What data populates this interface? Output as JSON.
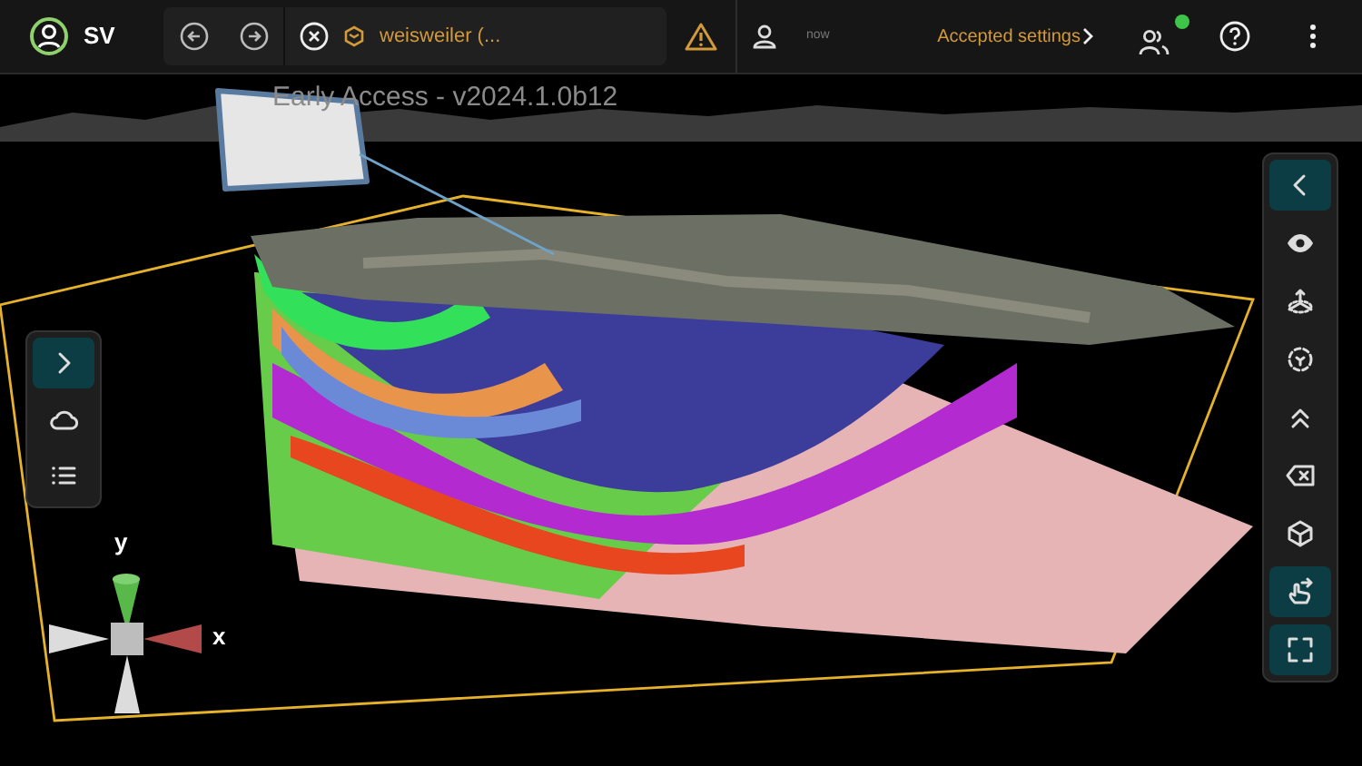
{
  "header": {
    "user_initials": "SV",
    "breadcrumb": "weisweiler (...",
    "warning": true,
    "activity_time": "now",
    "activity_message": "Accepted settings",
    "collaborators_online": true
  },
  "version": "Early Access - v2024.1.0b12",
  "left_toolbar": [
    {
      "kind": "expand",
      "active": true
    },
    {
      "kind": "cloud",
      "active": false
    },
    {
      "kind": "list",
      "active": false
    }
  ],
  "right_toolbar": [
    {
      "kind": "collapse",
      "active": true
    },
    {
      "kind": "eye",
      "active": false
    },
    {
      "kind": "axes",
      "active": false
    },
    {
      "kind": "select",
      "active": false
    },
    {
      "kind": "up",
      "active": false
    },
    {
      "kind": "clear",
      "active": false
    },
    {
      "kind": "cube",
      "active": false
    },
    {
      "kind": "gesture",
      "active": true
    },
    {
      "kind": "fullscreen",
      "active": true
    }
  ],
  "gizmo": {
    "y_label": "y",
    "x_label": "x"
  }
}
